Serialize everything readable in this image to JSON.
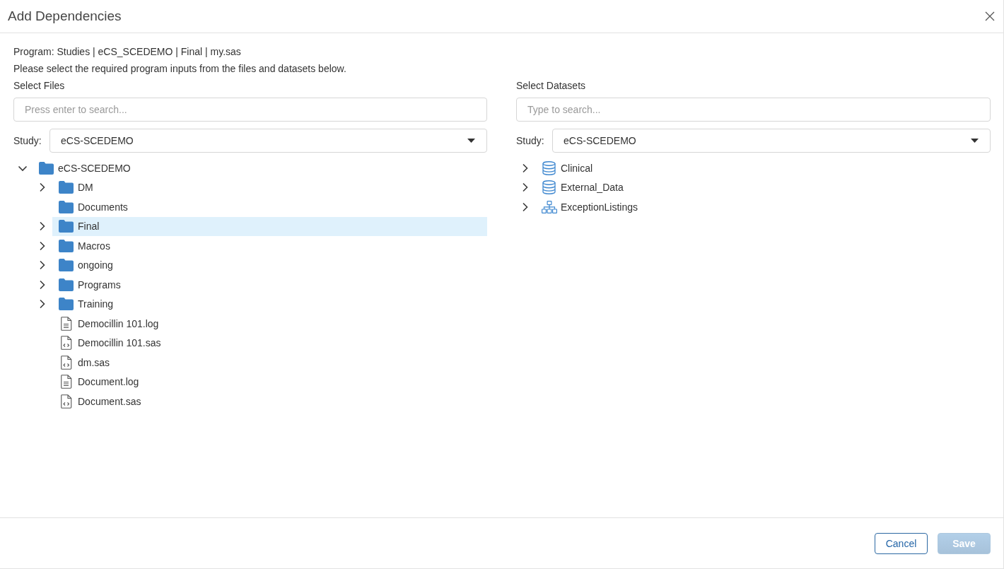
{
  "dialog": {
    "title": "Add Dependencies"
  },
  "program_line": "Program: Studies | eCS_SCEDEMO | Final | my.sas",
  "instructions": "Please select the required program inputs from the files and datasets below.",
  "files_panel": {
    "heading": "Select Files",
    "search": {
      "placeholder": "Press enter to search..."
    },
    "study": {
      "label": "Study:",
      "value": "eCS-SCEDEMO"
    },
    "tree": [
      {
        "label": "eCS-SCEDEMO",
        "kind": "folder",
        "expandable": true,
        "expanded": true,
        "selected": false,
        "children": [
          {
            "label": "DM",
            "kind": "folder",
            "expandable": true,
            "expanded": false,
            "selected": false
          },
          {
            "label": "Documents",
            "kind": "folder",
            "expandable": false,
            "expanded": false,
            "selected": false
          },
          {
            "label": "Final",
            "kind": "folder",
            "expandable": true,
            "expanded": false,
            "selected": true
          },
          {
            "label": "Macros",
            "kind": "folder",
            "expandable": true,
            "expanded": false,
            "selected": false
          },
          {
            "label": "ongoing",
            "kind": "folder",
            "expandable": true,
            "expanded": false,
            "selected": false
          },
          {
            "label": "Programs",
            "kind": "folder",
            "expandable": true,
            "expanded": false,
            "selected": false
          },
          {
            "label": "Training",
            "kind": "folder",
            "expandable": true,
            "expanded": false,
            "selected": false
          },
          {
            "label": "Democillin 101.log",
            "kind": "log",
            "expandable": false,
            "expanded": false,
            "selected": false
          },
          {
            "label": "Democillin 101.sas",
            "kind": "code",
            "expandable": false,
            "expanded": false,
            "selected": false
          },
          {
            "label": "dm.sas",
            "kind": "code",
            "expandable": false,
            "expanded": false,
            "selected": false
          },
          {
            "label": "Document.log",
            "kind": "log",
            "expandable": false,
            "expanded": false,
            "selected": false
          },
          {
            "label": "Document.sas",
            "kind": "code",
            "expandable": false,
            "expanded": false,
            "selected": false
          }
        ]
      }
    ]
  },
  "datasets_panel": {
    "heading": "Select Datasets",
    "search": {
      "placeholder": "Type to search..."
    },
    "study": {
      "label": "Study:",
      "value": "eCS-SCEDEMO"
    },
    "tree": [
      {
        "label": "Clinical",
        "kind": "database",
        "expandable": true,
        "expanded": false,
        "selected": false
      },
      {
        "label": "External_Data",
        "kind": "database",
        "expandable": true,
        "expanded": false,
        "selected": false
      },
      {
        "label": "ExceptionListings",
        "kind": "hierarchy",
        "expandable": true,
        "expanded": false,
        "selected": false
      }
    ]
  },
  "buttons": [
    {
      "label": "Cancel",
      "kind": "secondary",
      "disabled": false
    },
    {
      "label": "Save",
      "kind": "primary",
      "disabled": true
    }
  ]
}
